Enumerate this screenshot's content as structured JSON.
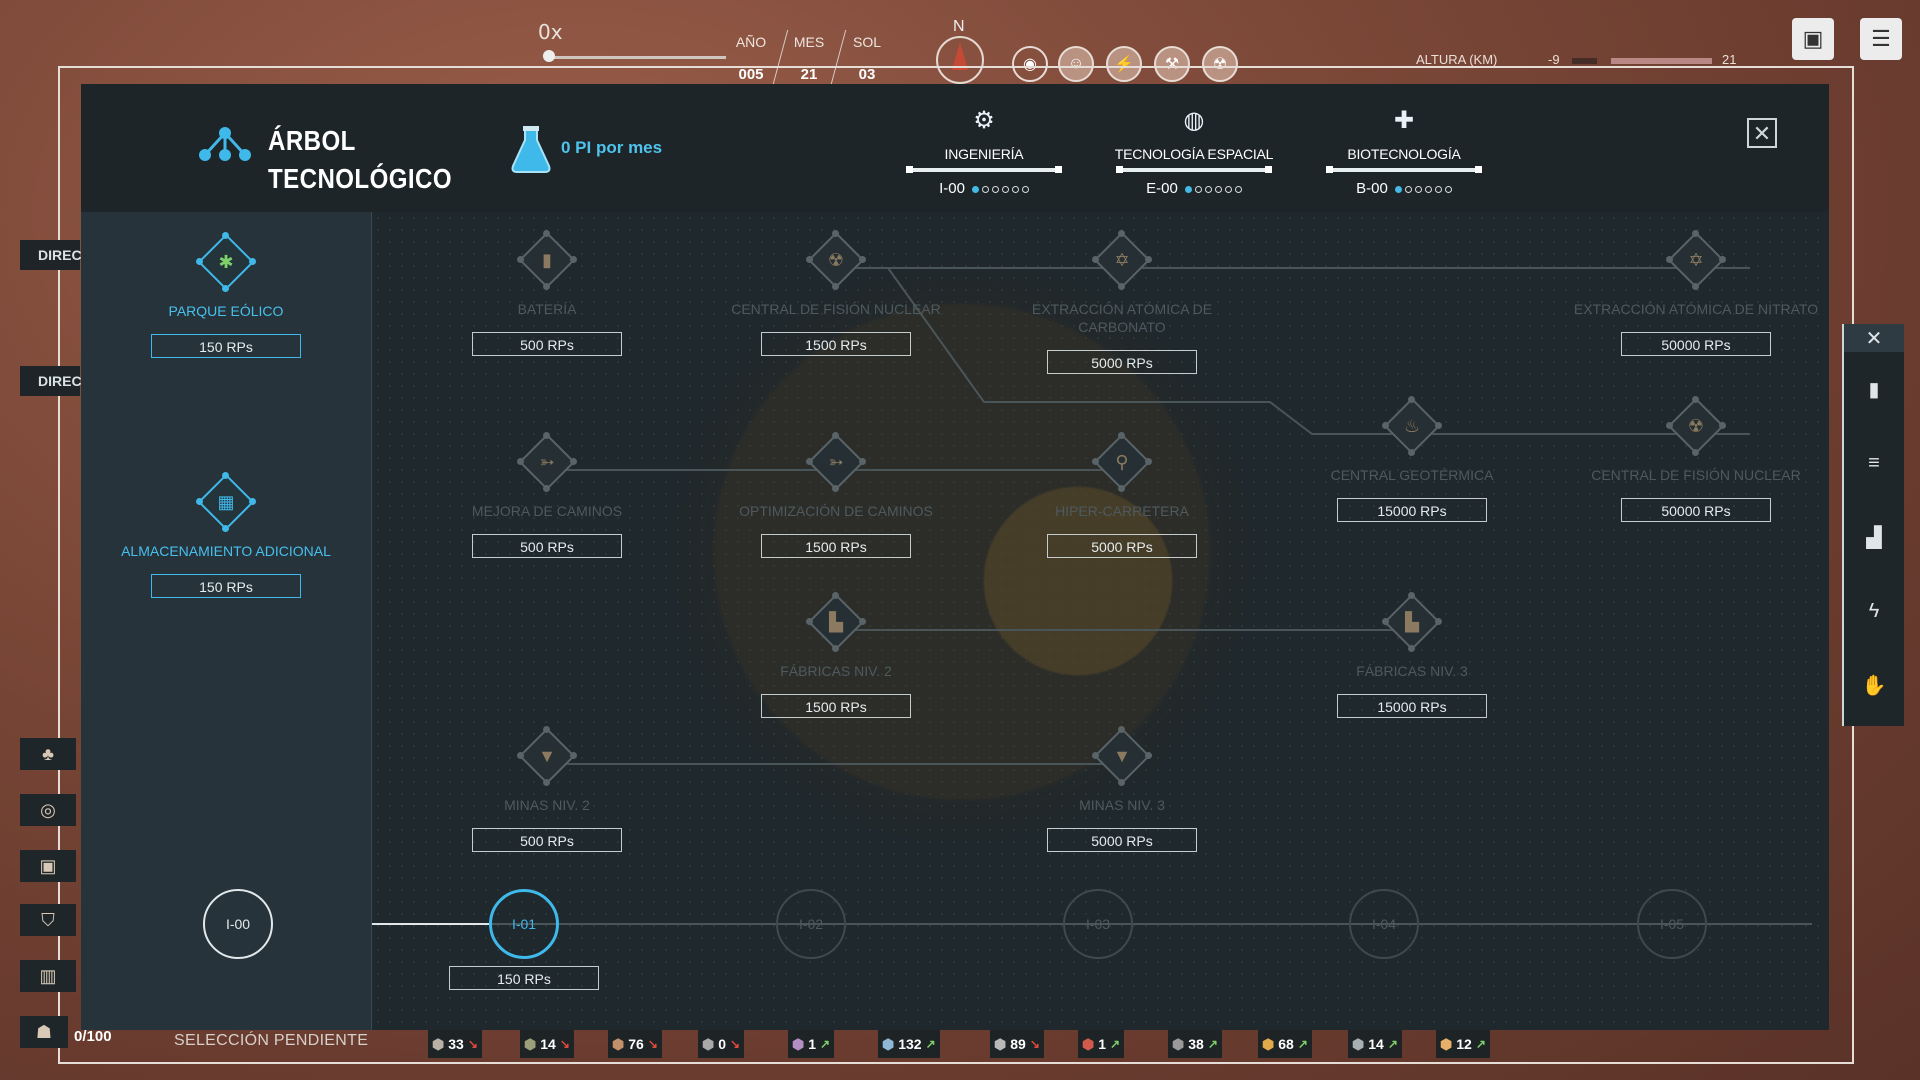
{
  "hud": {
    "speed": "0x",
    "date": {
      "labels": [
        "AÑO",
        "MES",
        "SOL"
      ],
      "values": [
        "005",
        "21",
        "03"
      ]
    },
    "compass_letter": "N",
    "altitude_label": "ALTURA (KM)",
    "altitude_min": "-9",
    "altitude_max": "21"
  },
  "panel": {
    "title_line1": "ÁRBOL",
    "title_line2": "TECNOLÓGICO",
    "research_rate": "0 PI por mes",
    "categories": [
      {
        "label": "INGENIERÍA",
        "level": "I-00",
        "icon": "gears-icon",
        "dots_on": 1,
        "dots_total": 6
      },
      {
        "label": "TECNOLOGÍA ESPACIAL",
        "level": "E-00",
        "icon": "planet-icon",
        "dots_on": 1,
        "dots_total": 6
      },
      {
        "label": "BIOTECNOLOGÍA",
        "level": "B-00",
        "icon": "medical-cross-icon",
        "dots_on": 1,
        "dots_total": 6
      }
    ],
    "close_label": "✕"
  },
  "left_nodes": [
    {
      "label": "PARQUE EÓLICO",
      "cost": "150 RPs",
      "icon": "wind-turbine-icon"
    },
    {
      "label": "ALMACENAMIENTO ADICIONAL",
      "cost": "150 RPs",
      "icon": "crates-icon"
    }
  ],
  "tree_nodes": [
    {
      "id": "bateria",
      "label": "BATERÍA",
      "cost": "500 RPs",
      "icon": "battery-icon"
    },
    {
      "id": "fision1",
      "label": "CENTRAL DE FISIÓN NUCLEAR",
      "cost": "1500 RPs",
      "icon": "nuclear-icon"
    },
    {
      "id": "carbonato",
      "label": "EXTRACCIÓN ATÓMICA DE CARBONATO",
      "cost": "5000 RPs",
      "icon": "atom-icon"
    },
    {
      "id": "nitrato",
      "label": "EXTRACCIÓN ATÓMICA DE NITRATO",
      "cost": "50000 RPs",
      "icon": "atom-icon"
    },
    {
      "id": "mejora",
      "label": "MEJORA DE CAMINOS",
      "cost": "500 RPs",
      "icon": "road-icon"
    },
    {
      "id": "optim",
      "label": "OPTIMIZACIÓN DE CAMINOS",
      "cost": "1500 RPs",
      "icon": "road-icon"
    },
    {
      "id": "hiper",
      "label": "HIPER-CARRETERA",
      "cost": "5000 RPs",
      "icon": "highway-icon"
    },
    {
      "id": "geoterm",
      "label": "CENTRAL GEOTÉRMICA",
      "cost": "15000 RPs",
      "icon": "geothermal-icon"
    },
    {
      "id": "fision2",
      "label": "CENTRAL DE FISIÓN NUCLEAR",
      "cost": "50000 RPs",
      "icon": "nuclear-icon"
    },
    {
      "id": "fab2",
      "label": "FÁBRICAS NIV. 2",
      "cost": "1500 RPs",
      "icon": "factory-icon"
    },
    {
      "id": "fab3",
      "label": "FÁBRICAS NIV. 3",
      "cost": "15000 RPs",
      "icon": "factory-icon"
    },
    {
      "id": "minas2",
      "label": "MINAS NIV. 2",
      "cost": "500 RPs",
      "icon": "drill-icon"
    },
    {
      "id": "minas3",
      "label": "MINAS NIV. 3",
      "cost": "5000 RPs",
      "icon": "drill-icon"
    }
  ],
  "levels": [
    "I-00",
    "I-01",
    "I-02",
    "I-03",
    "I-04",
    "I-05"
  ],
  "level_cost": "150 RPs",
  "left_tabs": {
    "dir1": "DIREC",
    "dir2": "DIREC"
  },
  "bottom": {
    "population": "0/100",
    "pending": "SELECCIÓN PENDIENTE",
    "resources": [
      {
        "value": "33",
        "trend": "down"
      },
      {
        "value": "14",
        "trend": "down"
      },
      {
        "value": "76",
        "trend": "down"
      },
      {
        "value": "0",
        "trend": "down"
      },
      {
        "value": "1",
        "trend": "up"
      },
      {
        "value": "132",
        "trend": "up"
      },
      {
        "value": "89",
        "trend": "down"
      },
      {
        "value": "1",
        "trend": "up"
      },
      {
        "value": "38",
        "trend": "up"
      },
      {
        "value": "68",
        "trend": "up"
      },
      {
        "value": "14",
        "trend": "up"
      },
      {
        "value": "12",
        "trend": "up"
      }
    ]
  },
  "colors": {
    "accent": "#3fb8ea",
    "panel": "#1c2326",
    "bg": "#7a4a3a"
  }
}
